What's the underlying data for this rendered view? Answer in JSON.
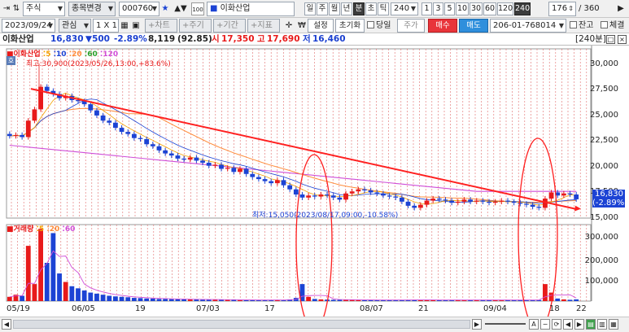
{
  "toolbar1": {
    "market_type": "주식",
    "switch_label": "종목변경",
    "stock_code": "000760",
    "stock_name": "이화산업",
    "period_buttons": [
      "일",
      "주",
      "월",
      "년",
      "분",
      "초",
      "틱"
    ],
    "active_period": "분",
    "interval_value": "240",
    "interval_buttons": [
      "1",
      "3",
      "5",
      "10",
      "30",
      "60",
      "120",
      "240"
    ],
    "active_interval": "240",
    "bars_shown": "176",
    "bars_total": "/ 360"
  },
  "toolbar2": {
    "date": "2023/09/24",
    "interest_label": "관심",
    "grid_label": "1 X 1",
    "tab_labels": [
      "차트",
      "주기",
      "기간",
      "지표"
    ],
    "settings_label": "설정",
    "reset_label": "초기화",
    "same_day_label": "당일",
    "price_label": "주가",
    "sell_label": "매수",
    "buy_label": "매도",
    "account": "206-01-768014",
    "balance_label": "잔고",
    "filled_label": "체결"
  },
  "quote": {
    "name": "이화산업",
    "price": "16,830",
    "change": "▼500",
    "change_pct": "-2.89%",
    "volume": "8,119",
    "volume_ratio": "(92.85)",
    "open_label": "시",
    "open": "17,350",
    "high_label": "고",
    "high": "17,690",
    "low_label": "저",
    "low": "16,460",
    "period_tag": "[240분]"
  },
  "price_legend": {
    "name": "이화산업",
    "ma": [
      "5",
      "10",
      "20",
      "60",
      "120"
    ]
  },
  "price_annotation_high": "최고:30,900(2023/05/26,13:00,+83.6%)",
  "price_annotation_low": "최저:15,050(2023/08/17,09:00,-10.58%)",
  "last_price_box": [
    "16,830",
    "(-2.89%)"
  ],
  "volume_legend": {
    "name": "거래량",
    "ma": [
      "5",
      "20",
      "60"
    ]
  },
  "volume_axis_ticks": [
    "300,000",
    "200,000",
    "100,000"
  ],
  "x_axis_ticks": [
    "05/19",
    "06/05",
    "19",
    "07/03",
    "17",
    "08/07",
    "21",
    "09/04",
    "18",
    "22"
  ],
  "colors": {
    "up": "#e81a1a",
    "down": "#1c43d4",
    "trend": "#ff2020",
    "ellipse": "#ff2020",
    "grid": "#e06a6a",
    "ma120": "#d04fd8",
    "ma60": "#ff8c3a"
  },
  "chart_data": {
    "type": "line",
    "title": "",
    "price_ylim": [
      15000,
      31500
    ],
    "price_ticks": [
      30000,
      27500,
      25000,
      22500,
      20000,
      17500,
      15000
    ],
    "close": [
      23000,
      23100,
      22900,
      24500,
      25600,
      27800,
      27400,
      27100,
      26700,
      26900,
      26500,
      26400,
      26100,
      25500,
      25000,
      24500,
      24300,
      23800,
      23400,
      23200,
      22800,
      22700,
      22200,
      22000,
      21600,
      21300,
      21100,
      20800,
      20700,
      20900,
      20600,
      20400,
      20100,
      20200,
      19800,
      19900,
      19500,
      19800,
      19300,
      19000,
      18800,
      18600,
      18400,
      18700,
      18200,
      17800,
      17300,
      17000,
      17200,
      17100,
      17300,
      17200,
      17000,
      16800,
      17400,
      17600,
      17800,
      17700,
      17500,
      17400,
      17200,
      17100,
      17000,
      16600,
      16200,
      16000,
      16300,
      16700,
      16900,
      16800,
      16700,
      16500,
      16600,
      16800,
      16600,
      16700,
      16600,
      16500,
      16600,
      16700,
      16600,
      16500,
      16400,
      16300,
      16100,
      16000,
      16900,
      17500,
      17200,
      17400,
      17300,
      16830
    ],
    "volume": [
      20000,
      30000,
      25000,
      260000,
      80000,
      340000,
      180000,
      320000,
      130000,
      90000,
      70000,
      60000,
      50000,
      40000,
      35000,
      30000,
      25000,
      22000,
      20000,
      18000,
      15000,
      14000,
      12000,
      12000,
      10000,
      10000,
      9000,
      9000,
      8000,
      8000,
      8000,
      7000,
      7000,
      7000,
      6000,
      6000,
      6000,
      5000,
      5000,
      5000,
      5000,
      5000,
      5000,
      6000,
      5000,
      8000,
      15000,
      80000,
      20000,
      10000,
      8000,
      7000,
      6000,
      6000,
      6000,
      6000,
      5000,
      5000,
      5000,
      5000,
      5000,
      5000,
      5000,
      5000,
      6000,
      6000,
      5000,
      5000,
      5000,
      5000,
      5000,
      5000,
      5000,
      5000,
      5000,
      5000,
      5000,
      5000,
      5000,
      5000,
      5000,
      5000,
      5000,
      5000,
      5000,
      5000,
      80000,
      40000,
      12000,
      8000,
      6000,
      8119
    ],
    "volume_ylim": [
      0,
      360000
    ],
    "trendline": {
      "from": 27600,
      "to": 15900
    },
    "annotations": [
      "최고:30,900",
      "최저:15,050"
    ]
  }
}
